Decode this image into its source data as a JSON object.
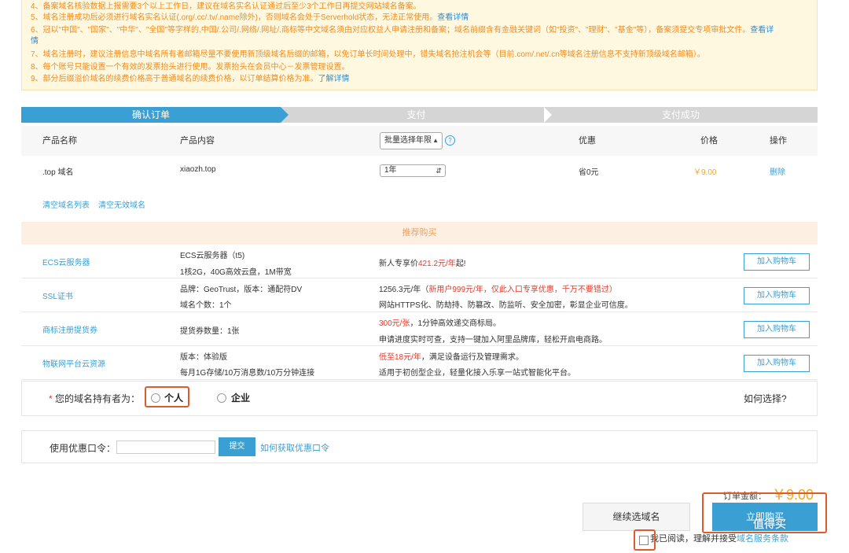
{
  "notice": {
    "lines": [
      {
        "text": "4、备案域名核验数据上报需要3个以上工作日，建议在域名实名认证通过后至少3个工作日再提交网站域名备案。",
        "link": ""
      },
      {
        "text": "5、域名注册成功后必须进行域名实名认证(.org/.cc/.tv/.name除外)，否则域名会处于Serverhold状态，无法正常使用。",
        "link": "查看详情"
      },
      {
        "text": "6、冠以\"中国\"、\"国家\"、\"中华\"、\"全国\"等字样的.中国/.公司/.网络/.网址/.商标等中文域名须由对应权益人申请注册和备案；域名前缀含有金融关键词（如\"投资\"、\"理财\"、\"基金\"等），备案须提交专项审批文件。",
        "link": "查看详"
      },
      {
        "text": "",
        "link": "情"
      },
      {
        "text": "7、域名注册时，建议注册信息中域名所有者邮箱尽量不要使用新顶级域名后缀的邮箱，以免订单长时间处理中，错失域名抢注机会等（目前.com/.net/.cn等域名注册信息不支持新顶级域名邮箱）。",
        "link": ""
      },
      {
        "text": "8、每个账号只能设置一个有效的发票抬头进行使用。发票抬头在会员中心－发票管理设置。",
        "link": ""
      },
      {
        "text": "9、部分后缀溢价域名的续费价格高于普通域名的续费价格，以订单结算价格为准。",
        "link": "了解详情"
      }
    ]
  },
  "steps": [
    "确认订单",
    "支付",
    "支付成功"
  ],
  "table": {
    "headers": {
      "name": "产品名称",
      "content": "产品内容",
      "batch_select": "批量选择年限",
      "discount": "优惠",
      "price": "价格",
      "action": "操作"
    },
    "rows": [
      {
        "name": ".top 域名",
        "content": "xiaozh.top",
        "years": "1年",
        "discount": "省0元",
        "price": "￥9.00",
        "action": "删除"
      }
    ]
  },
  "list_actions": {
    "clear_list": "清空域名列表",
    "clear_invalid": "清空无效域名"
  },
  "recommend": {
    "title": "推荐购买",
    "cart_label": "加入购物车",
    "items": [
      {
        "name": "ECS云服务器",
        "c1_line1": "ECS云服务器（t5)",
        "c1_line2": "1核2G，40G高效云盘，1M带宽",
        "c2_line1_a": "新人专享价",
        "c2_line1_red": "421.2元/年",
        "c2_line1_b": "起!",
        "c2_line2": ""
      },
      {
        "name": "SSL证书",
        "c1_line1": "品牌：GeoTrust，版本：通配符DV",
        "c1_line2": "域名个数：1个",
        "c2_line1_a": "1256.3元/年（",
        "c2_line1_red": "新用户999元/年，仅此入口专享优惠，千万不要错过）",
        "c2_line1_b": "",
        "c2_line2": "网站HTTPS化、防劫持、防篡改、防监听、安全加密，彰显企业可信度。"
      },
      {
        "name": "商标注册提货券",
        "c1_line1": "提货券数量：1张",
        "c1_line2": "",
        "c2_line1_a": "",
        "c2_line1_red": "300元/张",
        "c2_line1_b": "，1分钟高效递交商标局。",
        "c2_line2": "申请进度实时可查，支持一键加入阿里品牌库，轻松开启电商路。"
      },
      {
        "name": "物联网平台云资源",
        "c1_line1": "版本：体验版",
        "c1_line2": "每月1G存储/10万消息数/10万分钟连接",
        "c2_line1_a": "",
        "c2_line1_red": "低至18元/年",
        "c2_line1_b": "，满足设备运行及管理需求。",
        "c2_line2": "适用于初创型企业，轻量化接入乐享一站式智能化平台。"
      }
    ]
  },
  "holder": {
    "star": "*",
    "label": "您的域名持有者为：",
    "option_personal": "个人",
    "option_company": "企业",
    "how_to_choose": "如何选择?"
  },
  "coupon": {
    "label": "使用优惠口令：",
    "input_value": "",
    "submit": "提交",
    "how_link": "如何获取优惠口令"
  },
  "order": {
    "total_label": "订单金额：",
    "total_value": "￥9.00",
    "continue": "继续选域名",
    "buy_now": "立即购买",
    "agree_text": "我已阅读，理解并接受",
    "agree_link": "域名服务条款"
  },
  "watermark": "值得买",
  "colors": {
    "primary": "#3a9fd3",
    "price": "#f5a623",
    "notice_text": "#f08c1e",
    "notice_bg": "#fff8e1",
    "annotation": "#e25a2b",
    "red": "#e8392a"
  }
}
